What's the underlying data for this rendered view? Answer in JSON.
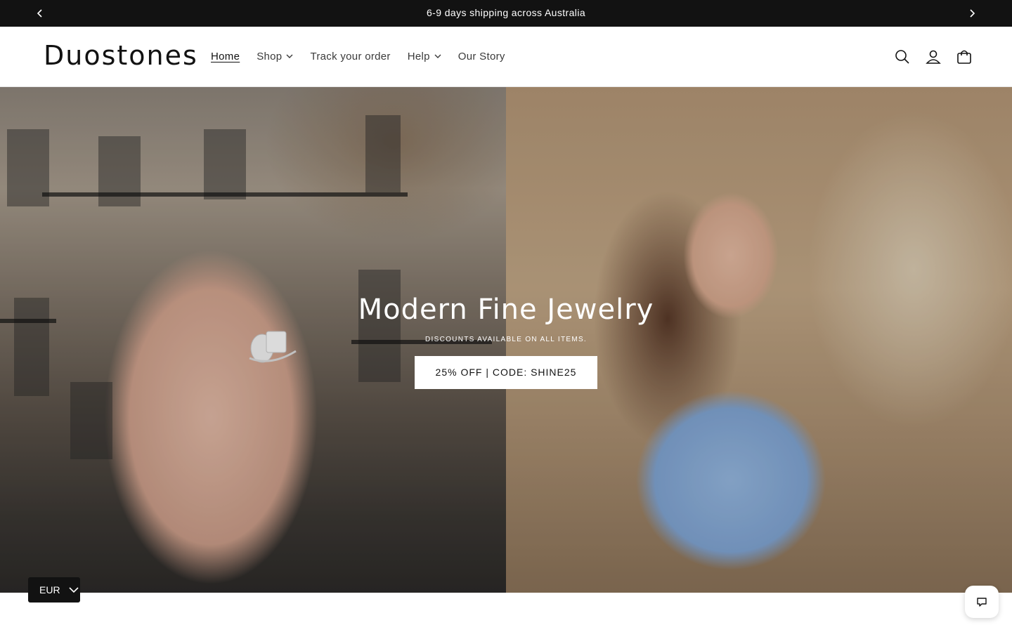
{
  "announcement": {
    "message": "6-9 days shipping across Australia",
    "prev_icon": "chevron-left-icon",
    "next_icon": "chevron-right-icon"
  },
  "header": {
    "logo": "Duostones",
    "nav": [
      {
        "label": "Home",
        "active": true,
        "has_dropdown": false
      },
      {
        "label": "Shop",
        "active": false,
        "has_dropdown": true
      },
      {
        "label": "Track your order",
        "active": false,
        "has_dropdown": false
      },
      {
        "label": "Help",
        "active": false,
        "has_dropdown": true
      },
      {
        "label": "Our Story",
        "active": false,
        "has_dropdown": false
      }
    ],
    "icons": [
      "search-icon",
      "account-icon",
      "cart-icon"
    ]
  },
  "hero": {
    "title": "Modern Fine Jewelry",
    "subtitle": "DISCOUNTS AVAILABLE ON ALL ITEMS.",
    "button_label": "25% OFF | CODE: SHINE25"
  },
  "currency": {
    "value": "EUR"
  },
  "chat": {
    "icon": "chat-icon"
  },
  "colors": {
    "announcement_bg": "#121212",
    "text": "#121212",
    "button_bg": "#ffffff"
  }
}
